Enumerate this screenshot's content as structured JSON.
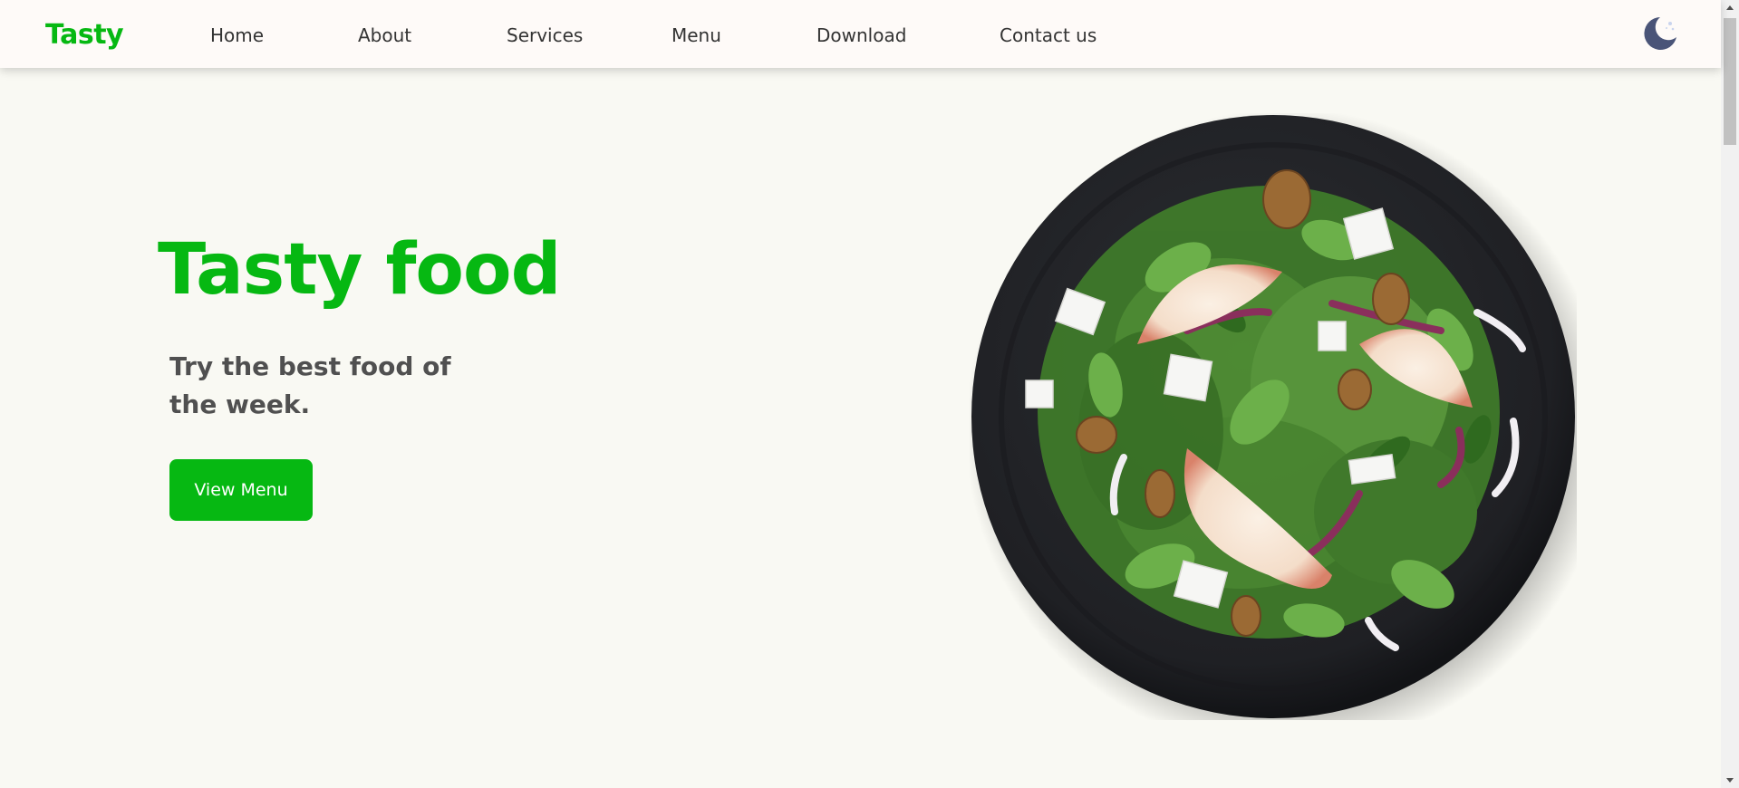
{
  "header": {
    "logo": "Tasty",
    "nav": [
      {
        "label": "Home"
      },
      {
        "label": "About"
      },
      {
        "label": "Services"
      },
      {
        "label": "Menu"
      },
      {
        "label": "Download"
      },
      {
        "label": "Contact us"
      }
    ],
    "theme_toggle_icon": "moon-icon"
  },
  "hero": {
    "title": "Tasty food",
    "subtitle": "Try the best food of the week.",
    "button_label": "View Menu",
    "image_icon": "salad-plate-image"
  },
  "colors": {
    "accent": "#06b812",
    "header_bg": "#fefaf8",
    "page_bg": "#f9f9f3",
    "heading_gray": "#505050"
  }
}
